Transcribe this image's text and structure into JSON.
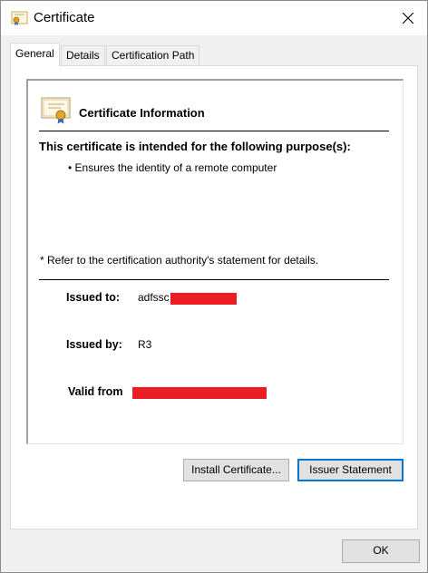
{
  "window": {
    "title": "Certificate",
    "title_icon": "certificate-icon",
    "close_icon": "close-icon"
  },
  "tabs": [
    {
      "label": "General",
      "active": true
    },
    {
      "label": "Details",
      "active": false
    },
    {
      "label": "Certification Path",
      "active": false
    }
  ],
  "general": {
    "heading": "Certificate Information",
    "heading_icon": "certificate-icon",
    "purpose_heading": "This certificate is intended for the following purpose(s):",
    "purposes": [
      "• Ensures the identity of a remote computer"
    ],
    "refer_note": "* Refer to the certification authority's statement for details.",
    "issued_to_label": "Issued to:",
    "issued_to_value": "adfssc",
    "issued_by_label": "Issued by:",
    "issued_by_value": "R3",
    "valid_from_label": "Valid from",
    "redaction_color": "#ec1c24"
  },
  "buttons": {
    "install_certificate": "Install Certificate...",
    "issuer_statement": "Issuer Statement",
    "ok": "OK"
  },
  "colors": {
    "focus_accent": "#0078d7",
    "dialog_background": "#f0f0f0"
  }
}
